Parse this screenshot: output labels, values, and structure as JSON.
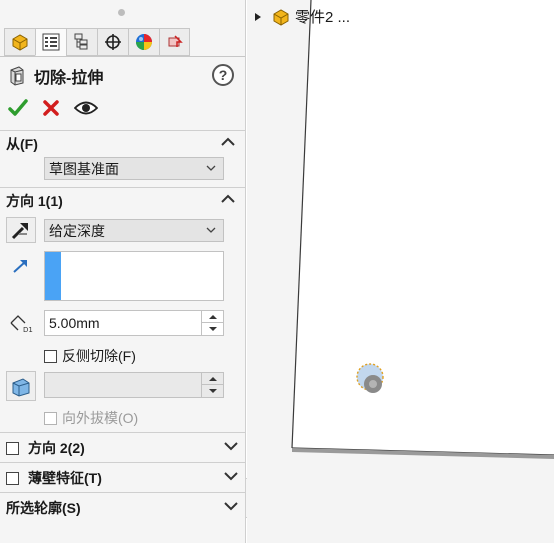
{
  "feature": {
    "title": "切除-拉伸",
    "help_label": "?"
  },
  "tabs": [
    {
      "name": "feature-manager-tab",
      "icon": "part-icon"
    },
    {
      "name": "property-manager-tab",
      "icon": "property-list-icon",
      "active": true
    },
    {
      "name": "configuration-manager-tab",
      "icon": "configuration-icon"
    },
    {
      "name": "dimxpert-tab",
      "icon": "crosshair-icon"
    },
    {
      "name": "display-manager-tab",
      "icon": "appearance-sphere-icon"
    },
    {
      "name": "cam-tab",
      "icon": "cam-icon"
    }
  ],
  "from_section": {
    "label": "从(F)",
    "value": "草图基准面"
  },
  "direction1": {
    "label": "方向 1(1)",
    "end_condition": "给定深度",
    "depth": "5.00mm",
    "flip_side_label": "反侧切除(F)",
    "draft_outward_label": "向外拔模(O)"
  },
  "collapsed_sections": [
    {
      "label": "方向 2(2)",
      "has_checkbox": true
    },
    {
      "label": "薄壁特征(T)",
      "has_checkbox": true
    },
    {
      "label": "所选轮廓(S)",
      "has_checkbox": false
    }
  ],
  "tree": {
    "root_label": "零件2 ..."
  },
  "colors": {
    "accept": "#2e9d2e",
    "cancel": "#d21d1d",
    "selection_bar": "#4aa3f5"
  }
}
